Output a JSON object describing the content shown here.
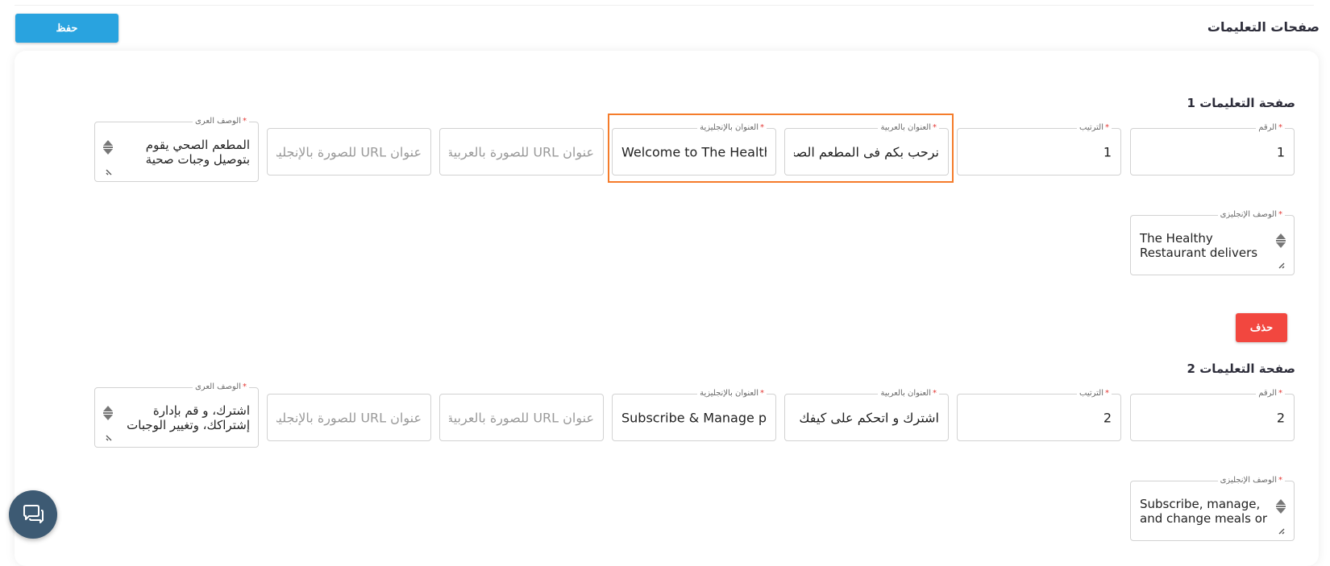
{
  "header": {
    "page_title": "صفحات التعليمات",
    "save_label": "حفظ"
  },
  "labels": {
    "number": "الرقم",
    "order": "الترتيب",
    "title_ar": "العنوان بالعربية",
    "title_en": "العنوان بالإنجليزية",
    "desc_ar": "الوصف العرى",
    "desc_en": "الوصف الإنجليزى",
    "required_mark": "*"
  },
  "placeholders": {
    "image_url_ar": "عنوان URL للصورة بالعربية",
    "image_url_en": "عنوان URL للصورة بالإنجليزية"
  },
  "sections": [
    {
      "title": "صفحة التعليمات 1",
      "number": "1",
      "order": "1",
      "title_ar": "نرحب بكم فى المطعم الصحى",
      "title_en": "Welcome to The Healthy Restaurant",
      "desc_ar": "المطعم الصحي يقوم بتوصيل وجبات صحية",
      "desc_en": "The Healthy Restaurant delivers"
    },
    {
      "title": "صفحة التعليمات 2",
      "number": "2",
      "order": "2",
      "title_ar": "اشترك و اتحكم على كيفك",
      "title_en": "Subscribe & Manage personally",
      "desc_ar": "اشترك، و قم بإدارة إشتراكك، وتغيير الوجبات",
      "desc_en": "Subscribe, manage, and change meals or"
    }
  ],
  "delete_label": "حذف",
  "colors": {
    "primary": "#29a3df",
    "danger": "#f2473f",
    "highlight": "#f57c2b",
    "required": "#e53935",
    "chat": "#3d5a73"
  },
  "icons": {
    "chat": "chat-bubbles-icon",
    "spinner": "spinner-icon",
    "resize": "resize-grip-icon"
  }
}
